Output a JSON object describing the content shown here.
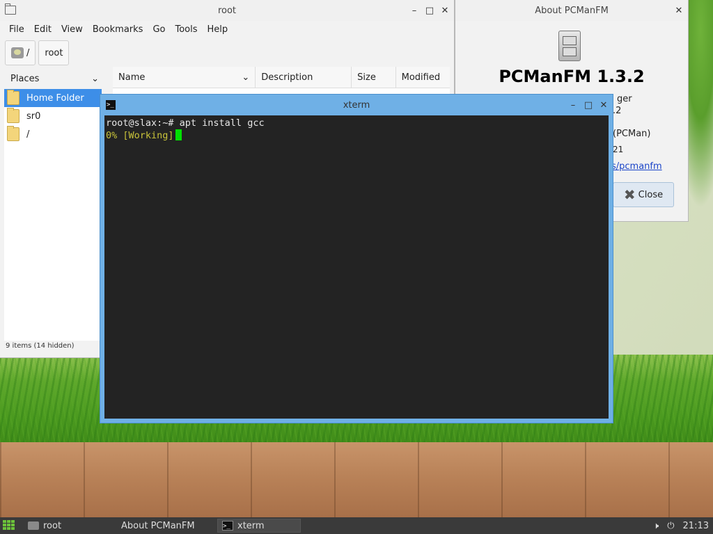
{
  "file_manager": {
    "title": "root",
    "menu": [
      "File",
      "Edit",
      "View",
      "Bookmarks",
      "Go",
      "Tools",
      "Help"
    ],
    "path_buttons": [
      "/",
      "root"
    ],
    "sidebar": {
      "header": "Places",
      "items": [
        {
          "label": "Home Folder",
          "selected": true
        },
        {
          "label": "sr0",
          "selected": false
        },
        {
          "label": "/",
          "selected": false
        }
      ]
    },
    "columns": [
      "Name",
      "Description",
      "Size",
      "Modified"
    ],
    "status": "9 items (14 hidden)"
  },
  "about": {
    "title": "About PCManFM",
    "app_name": "PCManFM 1.3.2",
    "lines": [
      "ger",
      ".2",
      "(PCMan)",
      "21"
    ],
    "link": "s/pcmanfm",
    "close_label": "Close"
  },
  "xterm": {
    "title": "xterm",
    "command_line": "root@slax:~# apt install gcc",
    "progress_line": "0% [Working]"
  },
  "taskbar": {
    "tasks": [
      {
        "label": "root",
        "active": false
      },
      {
        "label": "About PCManFM",
        "active": false
      },
      {
        "label": "xterm",
        "active": true
      }
    ],
    "clock": "21:13"
  },
  "colors": {
    "selection": "#3d8ee8",
    "xterm_frame": "#6fb0e6",
    "terminal_bg": "#232323",
    "cursor": "#00e000",
    "progress_text": "#c8c33a"
  }
}
